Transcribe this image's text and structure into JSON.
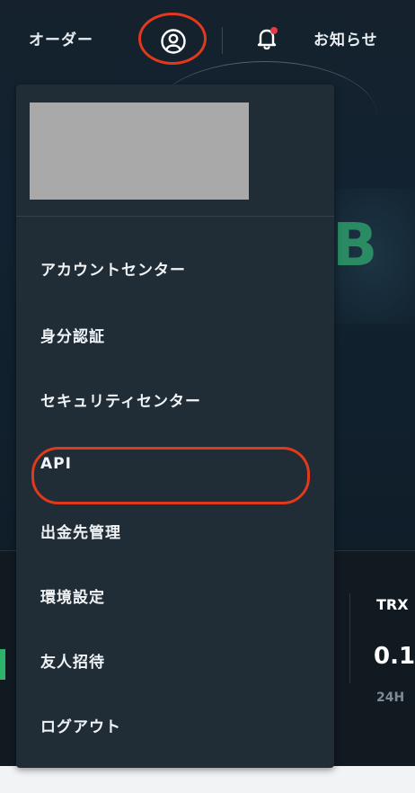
{
  "nav": {
    "orders_label": "オーダー",
    "news_label": "お知らせ",
    "user_icon": "user-circle-icon",
    "bell_icon": "bell-icon",
    "bell_has_unread": true
  },
  "dropdown": {
    "items": [
      {
        "label": "アカウントセンター"
      },
      {
        "label": "身分認証"
      },
      {
        "label": "セキュリティセンター"
      },
      {
        "label": "API"
      },
      {
        "label": "出金先管理"
      },
      {
        "label": "環境設定"
      },
      {
        "label": "友人招待"
      },
      {
        "label": "ログアウト"
      }
    ]
  },
  "background": {
    "coin_symbol": "B",
    "ticker": {
      "symbol": "TRX",
      "price": "0.1",
      "label_24h": "24H"
    }
  },
  "colors": {
    "annotation": "#e2391c",
    "dropdown_bg": "#202c36",
    "accent_green": "#2e9b6a",
    "notification": "#e53946"
  }
}
